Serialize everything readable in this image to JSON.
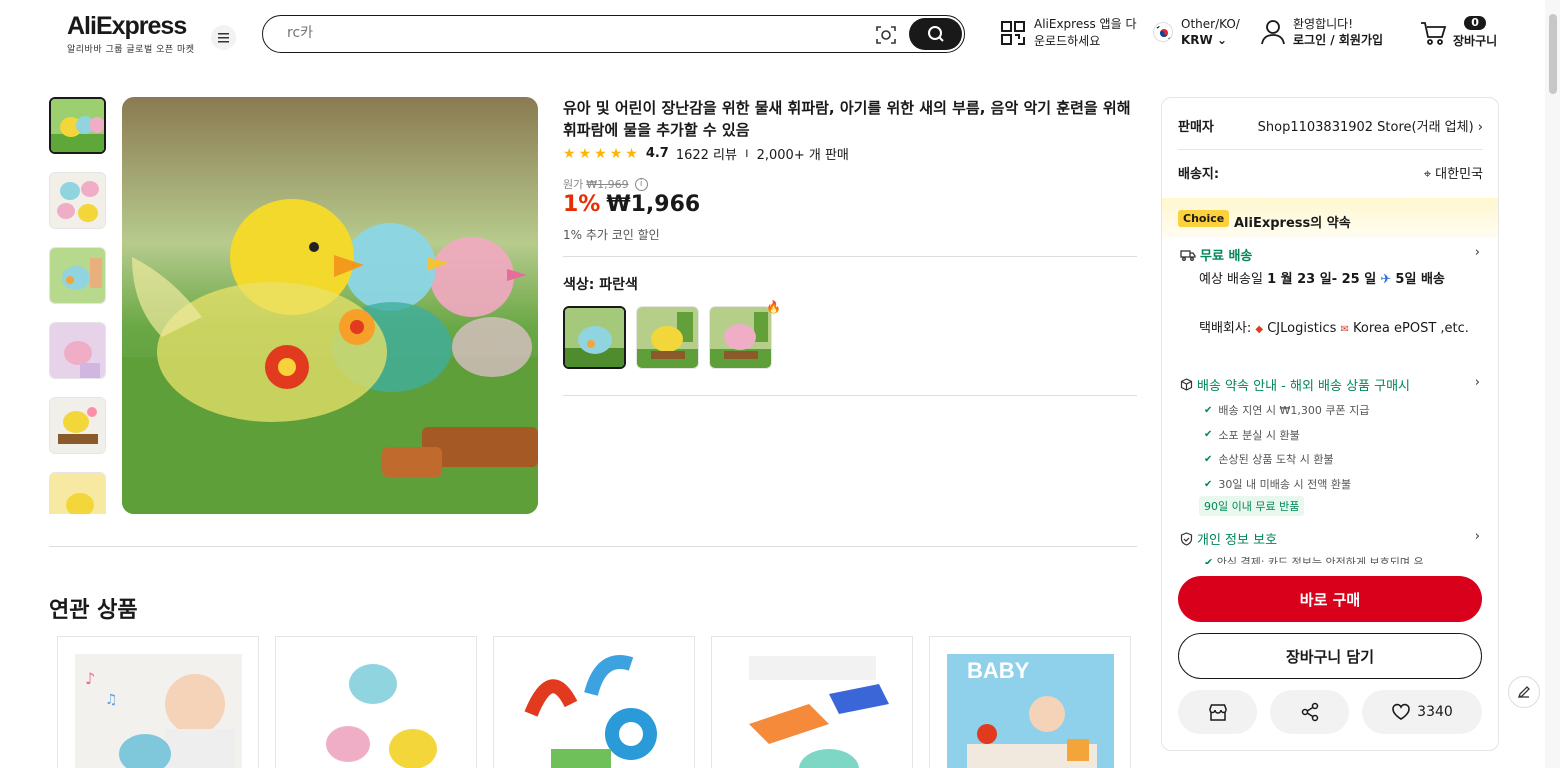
{
  "header": {
    "logo": "AliExpress",
    "logo_tagline": "알리바바 그룹 글로벌 오픈 마켓",
    "search_placeholder": "rc카",
    "app_download": "AliExpress 앱을 다운로드하세요",
    "region": "Other/KO/",
    "currency": "KRW",
    "greeting": "환영합니다!",
    "login": "로그인 / 회원가입",
    "cart_count": "0",
    "cart_label": "장바구니"
  },
  "product": {
    "title": "유아 및 어린이 장난감을 위한 물새 휘파람, 아기를 위한 새의 부름, 음악 악기 훈련을 위해 휘파람에 물을 추가할 수 있음",
    "rating": "4.7",
    "reviews": "1622 리뷰",
    "sold": "2,000+ 개 판매",
    "original_label": "원가",
    "original_price": "₩1,969",
    "discount": "1%",
    "price": "₩1,966",
    "coin_note": "1% 추가 코인 할인",
    "color_label": "색상: 파란색"
  },
  "related": {
    "title": "연관 상품"
  },
  "panel": {
    "seller_label": "판매자",
    "seller_name": "Shop1103831902 Store(거래 업체)",
    "ship_to_label": "배송지:",
    "ship_to": "대한민국",
    "choice_badge": "Choice",
    "choice_text": "AliExpress의 약속",
    "free_shipping": "무료 배송",
    "eta_prefix": "예상 배송일",
    "eta_dates": "1 월 23 일- 25 일",
    "eta_days": "5일 배송",
    "carrier_label": "택배회사:",
    "carrier_1": "CJLogistics",
    "carrier_2": "Korea ePOST ,etc.",
    "promise": "배송 약속 안내 - 해외 배송 상품 구매시",
    "checks": [
      "배송 지연 시 ₩1,300 쿠폰 지급",
      "소포 분실 시 환불",
      "손상된 상품 도착 시 환불",
      "30일 내 미배송 시 전액 환불"
    ],
    "return_badge": "90일 이내 무료 반품",
    "privacy": "개인 정보 보호",
    "privacy_sub": "안심 결제: 카드 정보는 안전하게 보호되며 유",
    "buy_now": "바로 구매",
    "add_to_cart": "장바구니 담기",
    "wishlist_count": "3340"
  },
  "colors": {
    "accent_red": "#d9001b",
    "price_red": "#e62e04",
    "green": "#00875a",
    "choice_yellow": "#fdd03d"
  }
}
